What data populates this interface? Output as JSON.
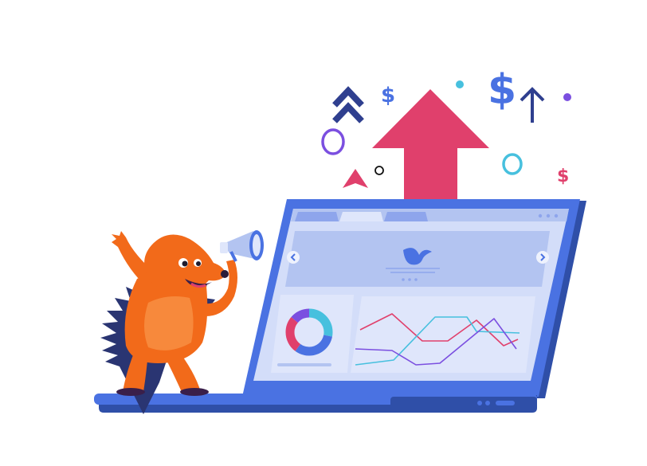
{
  "colors": {
    "pink": "#e0406c",
    "blue": "#4a72e2",
    "navy": "#2f3f8f",
    "purple": "#7b4fe0",
    "cyan": "#47c0de",
    "orange": "#f26a1a",
    "screen": "#d3ddf9",
    "panel": "#b3c4f1"
  },
  "decor": {
    "dollar_symbol": "$"
  },
  "laptop": {
    "logo_icon": "bird-icon",
    "donut_segments": [
      {
        "name": "cyan",
        "fraction": 0.28
      },
      {
        "name": "blue",
        "fraction": 0.32
      },
      {
        "name": "pink",
        "fraction": 0.26
      },
      {
        "name": "purple",
        "fraction": 0.14
      }
    ]
  },
  "mascot": {
    "icon": "hedgehog-icon",
    "prop": "megaphone-icon"
  }
}
